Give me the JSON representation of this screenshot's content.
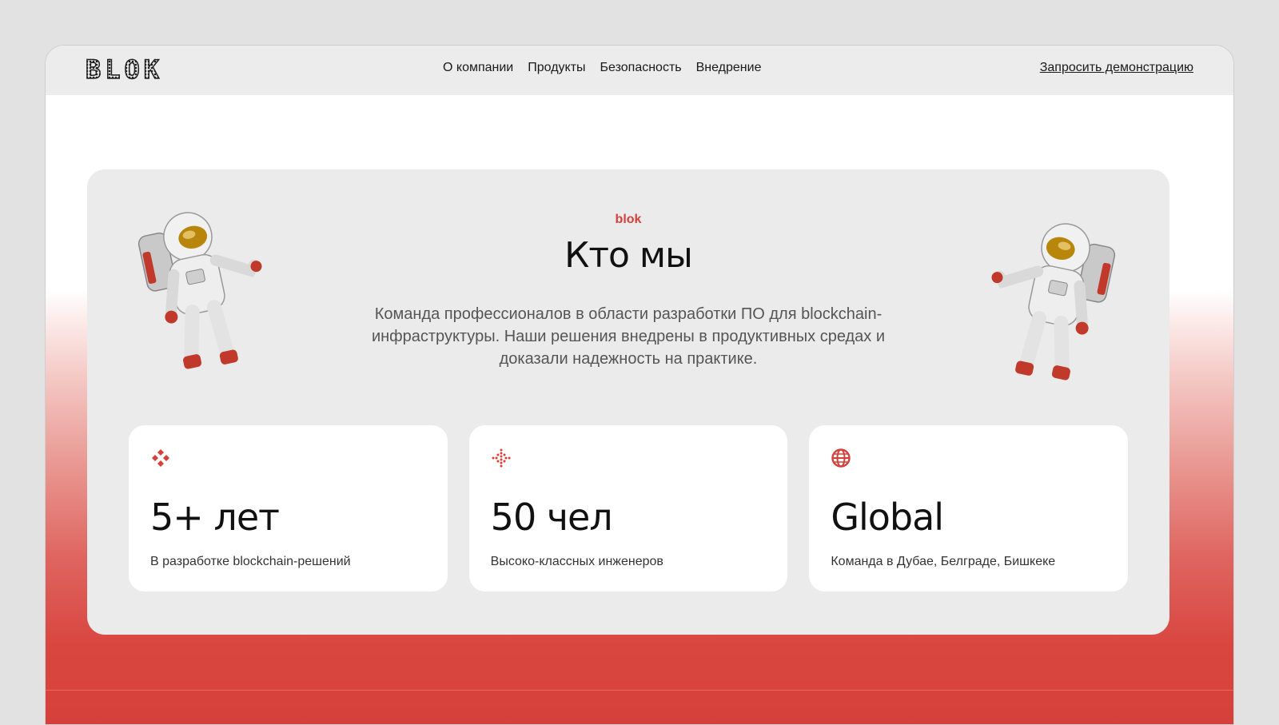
{
  "header": {
    "logo_letters": [
      "B",
      "L",
      "O",
      "K"
    ],
    "nav": [
      "О компании",
      "Продукты",
      "Безопасность",
      "Внедрение"
    ],
    "cta": "Запросить демонстрацию"
  },
  "about": {
    "eyebrow": "blok",
    "title": "Кто мы",
    "description": "Команда профессионалов в области разработки ПО для blockchain-инфраструктуры. Наши решения внедрены в продуктивных средах и доказали надежность на практике."
  },
  "stats": [
    {
      "icon": "crosshair-icon",
      "value": "5+ лет",
      "caption": "В разработке blockchain-решений"
    },
    {
      "icon": "dotted-cross-icon",
      "value": "50 чел",
      "caption": "Высоко-классных инженеров"
    },
    {
      "icon": "globe-icon",
      "value": "Global",
      "caption": "Команда в Дубае, Белграде, Бишкеке"
    }
  ],
  "colors": {
    "accent": "#d6403a",
    "panel": "#ebebeb",
    "header": "#ececec"
  }
}
